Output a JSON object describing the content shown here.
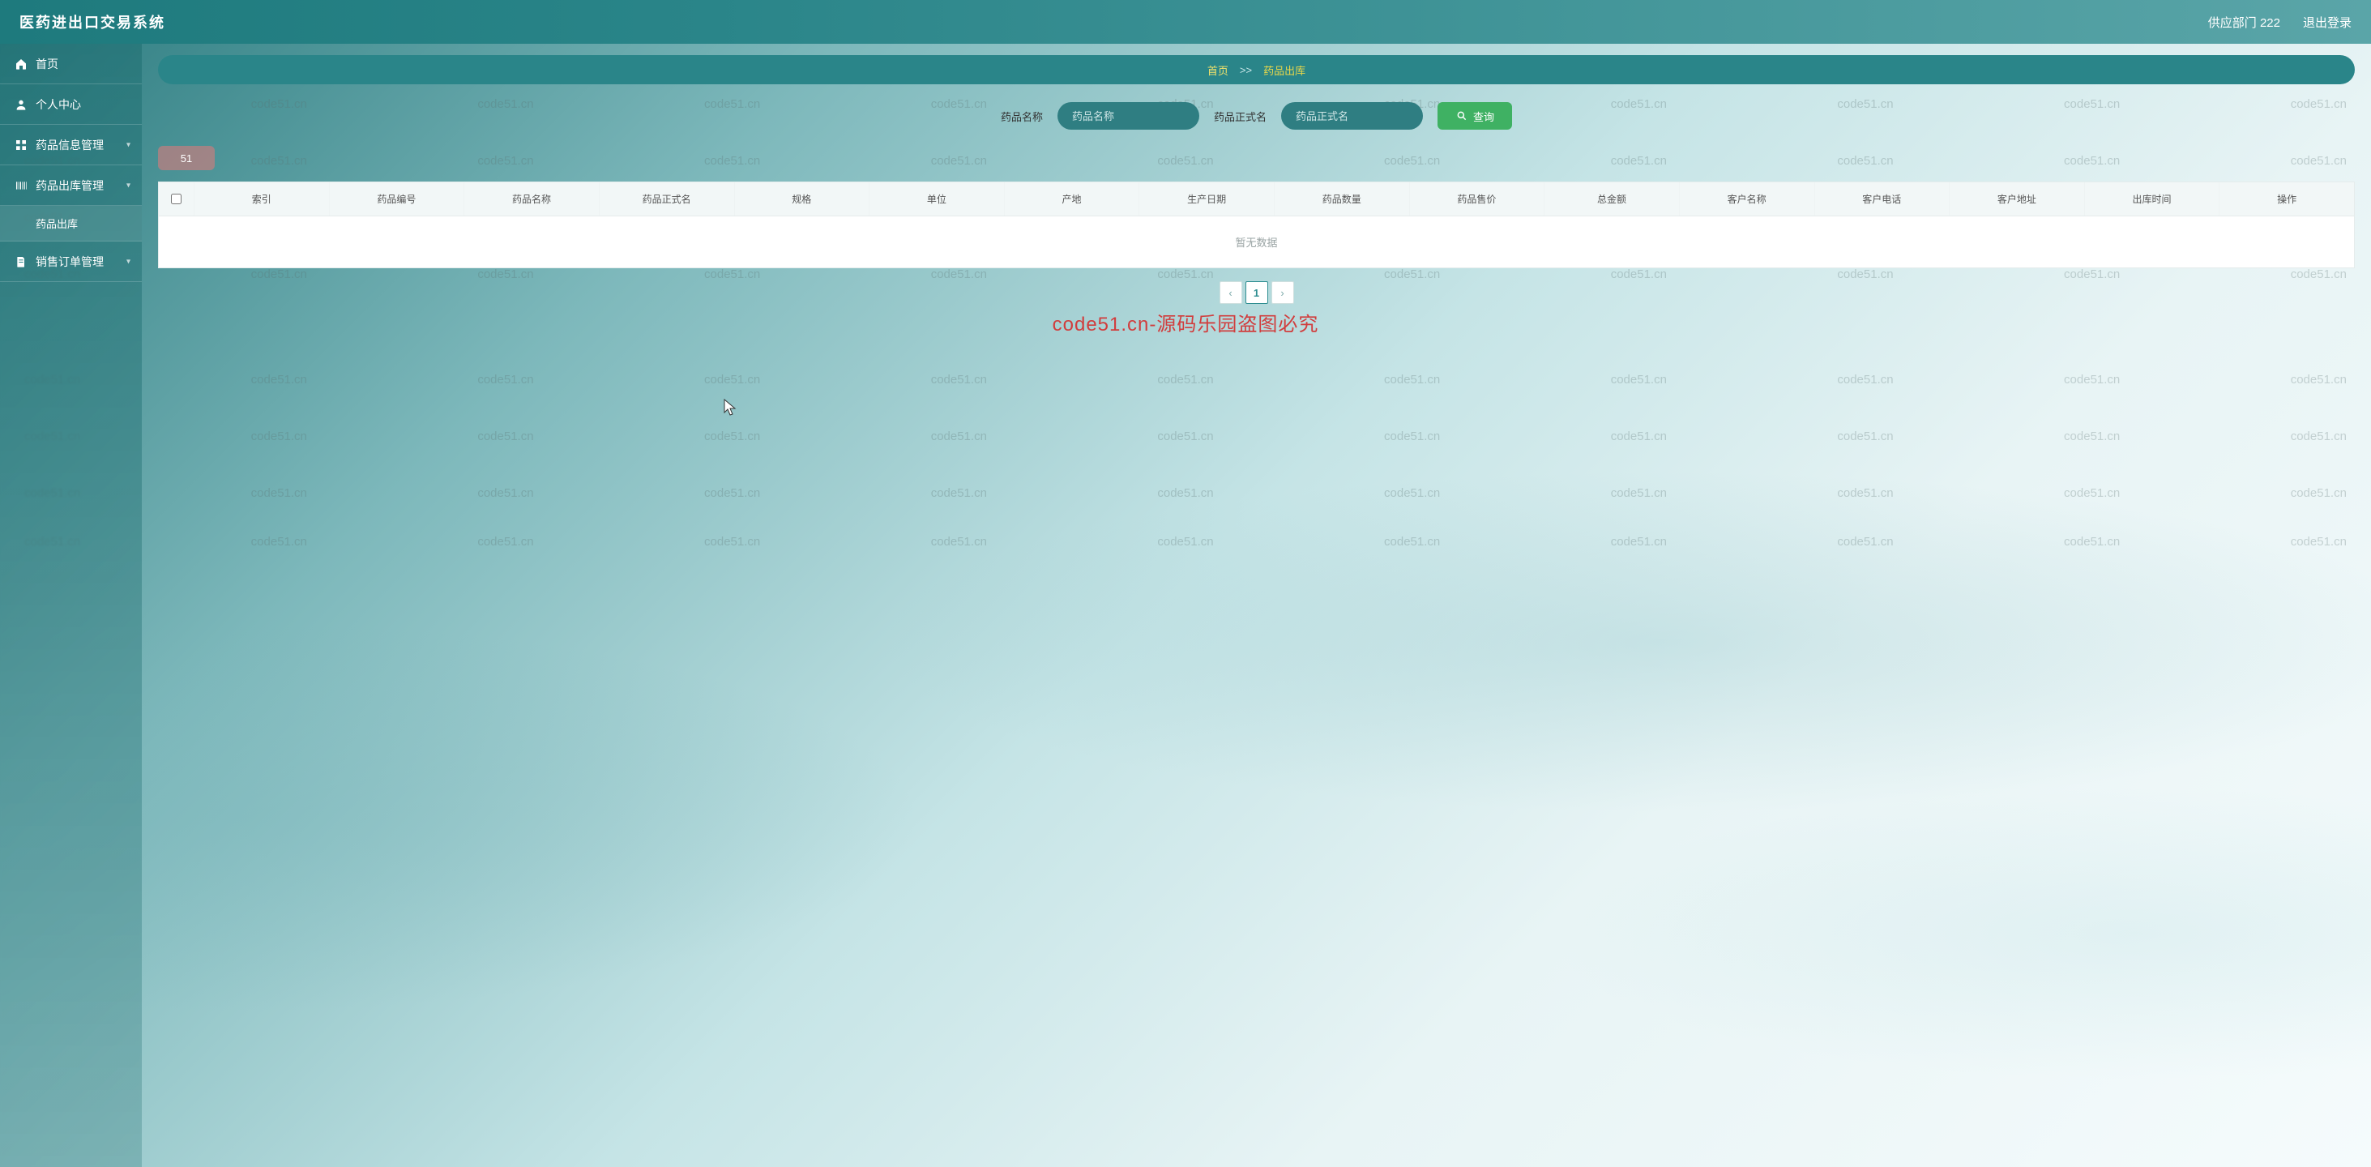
{
  "app": {
    "title": "医药进出口交易系统"
  },
  "header": {
    "user_label": "供应部门 222",
    "logout_label": "退出登录"
  },
  "sidebar": {
    "items": [
      {
        "label": "首页",
        "icon": "home"
      },
      {
        "label": "个人中心",
        "icon": "user"
      },
      {
        "label": "药品信息管理",
        "icon": "grid",
        "expandable": true
      },
      {
        "label": "药品出库管理",
        "icon": "barcode",
        "expandable": true,
        "children": [
          {
            "label": "药品出库",
            "active": true
          }
        ]
      },
      {
        "label": "销售订单管理",
        "icon": "doc",
        "expandable": true
      }
    ]
  },
  "breadcrumb": {
    "home": "首页",
    "sep": ">>",
    "current": "药品出库"
  },
  "search": {
    "field1_label": "药品名称",
    "field1_placeholder": "药品名称",
    "field2_label": "药品正式名",
    "field2_placeholder": "药品正式名",
    "button_label": "查询"
  },
  "badge": {
    "text": "51"
  },
  "table": {
    "columns": [
      "索引",
      "药品编号",
      "药品名称",
      "药品正式名",
      "规格",
      "单位",
      "产地",
      "生产日期",
      "药品数量",
      "药品售价",
      "总金额",
      "客户名称",
      "客户电话",
      "客户地址",
      "出库时间",
      "操作"
    ],
    "rows": [],
    "empty_text": "暂无数据"
  },
  "pager": {
    "prev": "‹",
    "page": "1",
    "next": "›"
  },
  "watermark": {
    "text": "code51.cn",
    "center": "code51.cn-源码乐园盗图必究"
  },
  "colors": {
    "primary": "#2a8589",
    "accent_green": "#3fb163",
    "accent_yellow": "#e9d84a"
  }
}
